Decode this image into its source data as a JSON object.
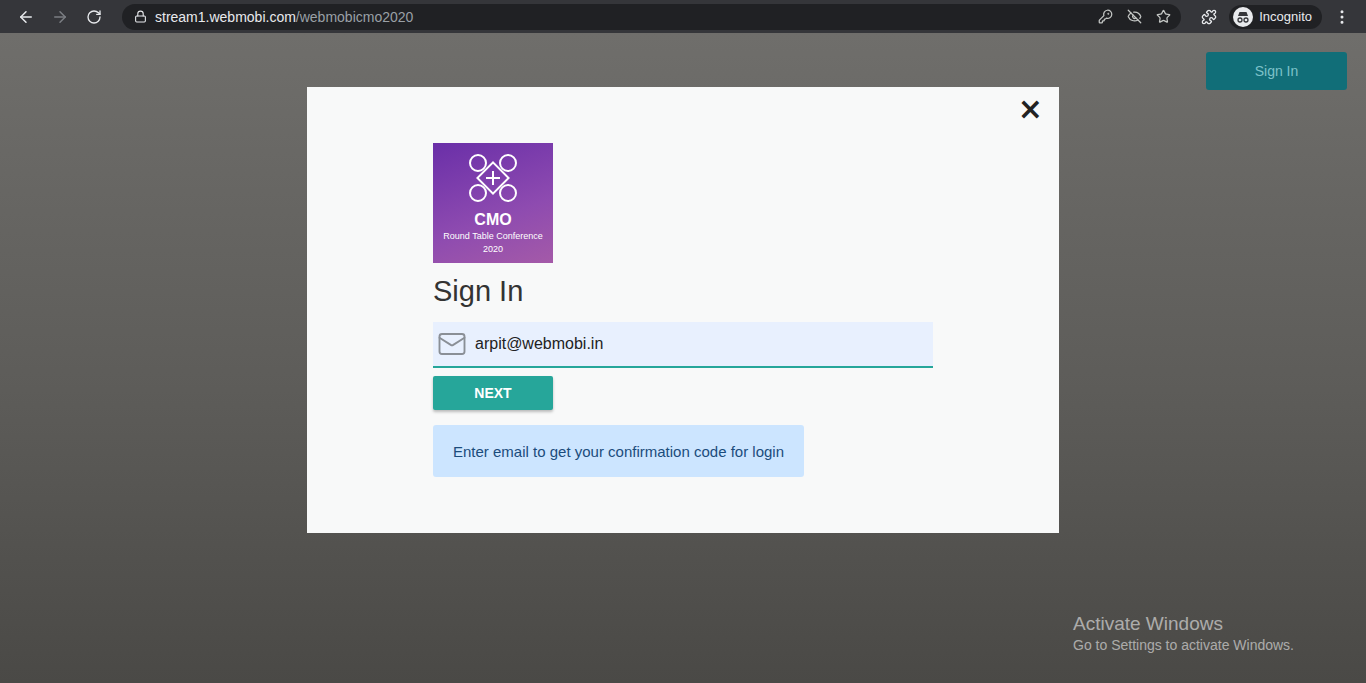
{
  "browser": {
    "url_host": "stream1.webmobi.com",
    "url_path": "/webmobicmo2020",
    "profile": "Incognito",
    "back_enabled": true,
    "forward_enabled": false
  },
  "page": {
    "sign_in_button": "Sign In"
  },
  "modal": {
    "close": "×",
    "logo": {
      "title": "CMO",
      "subtitle_lines": [
        "Round Table Conference",
        "2020"
      ]
    },
    "heading": "Sign In",
    "email": {
      "value": "arpit@webmobi.in"
    },
    "next_button": "NEXT",
    "info": "Enter email to get your confirmation code for login"
  },
  "watermark": {
    "title": "Activate Windows",
    "subtitle": "Go to Settings to activate Windows."
  }
}
